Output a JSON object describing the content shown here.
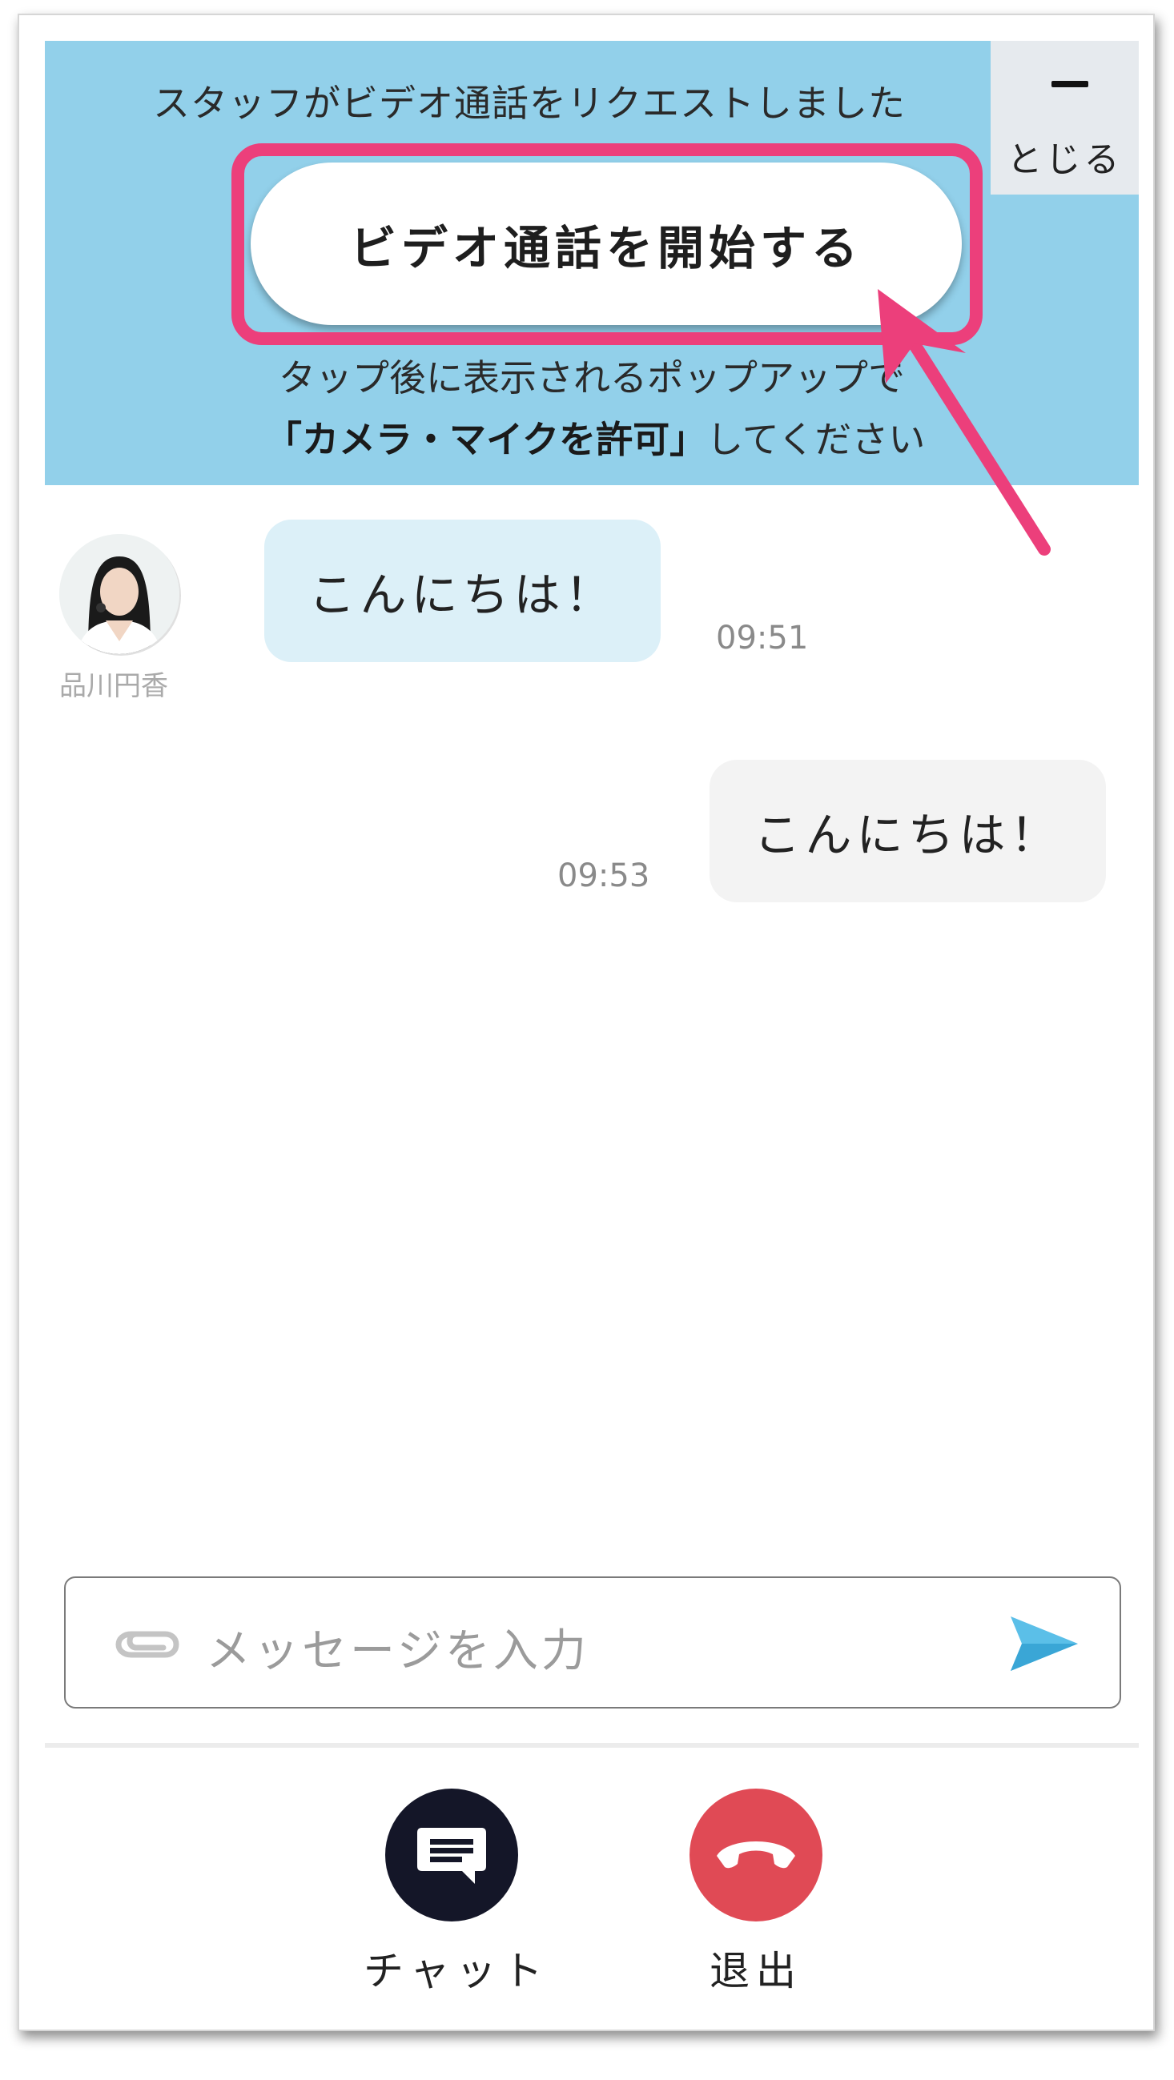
{
  "banner": {
    "title": "スタッフがビデオ通話をリクエストしました",
    "close_label": "とじる",
    "start_button": "ビデオ通話を開始する",
    "instruction_line1": "タップ後に表示されるポップアップで",
    "instruction_bold": "「カメラ・マイクを許可」",
    "instruction_rest": "してください"
  },
  "messages": {
    "incoming": {
      "sender": "品川円香",
      "text": "こんにちは！",
      "time": "09:51"
    },
    "outgoing": {
      "text": "こんにちは！",
      "time": "09:53"
    }
  },
  "composer": {
    "placeholder": "メッセージを入力",
    "attach_icon": "paperclip-icon",
    "send_icon": "send-icon"
  },
  "actions": {
    "chat_label": "チャット",
    "exit_label": "退出"
  },
  "colors": {
    "banner_bg": "#92d0ea",
    "highlight": "#ec3f7b",
    "incoming_bubble": "#dcf0f8",
    "outgoing_bubble": "#f3f3f3",
    "chat_button": "#141628",
    "exit_button": "#e04a55",
    "send": "#5bbfe8"
  }
}
